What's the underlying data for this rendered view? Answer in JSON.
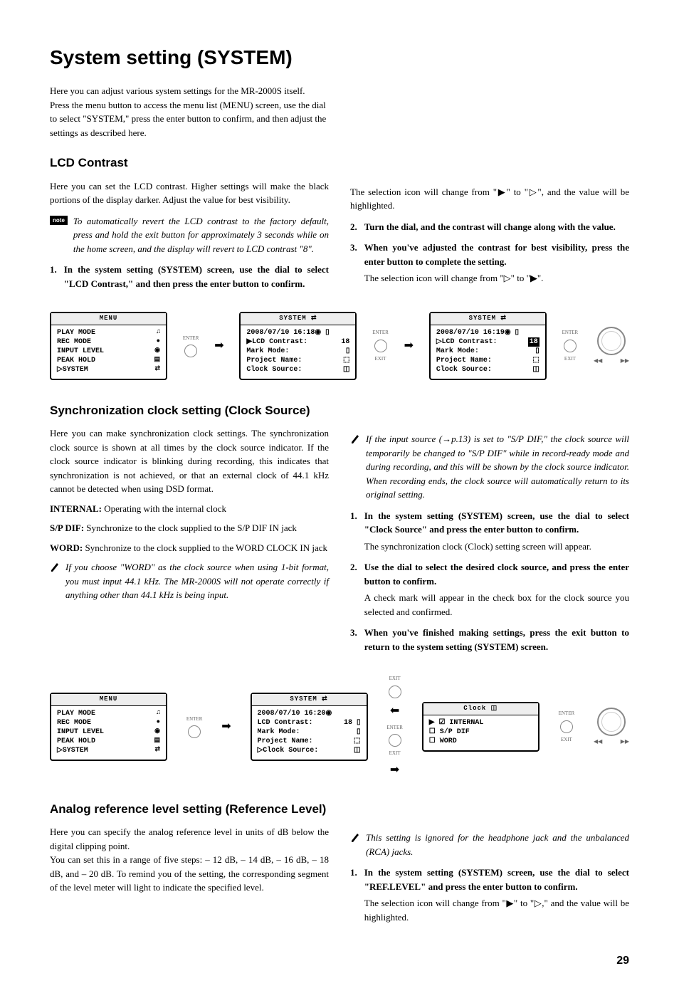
{
  "page": {
    "title": "System setting (SYSTEM)",
    "page_number": "29"
  },
  "intro": {
    "p1": "Here you can adjust various system settings for the MR-2000S itself.",
    "p2": "Press the menu button to access the menu list (MENU) screen, use the dial to select \"SYSTEM,\" press the enter button to confirm, and then adjust the settings as described here."
  },
  "lcd": {
    "title": "LCD Contrast",
    "p1": "Here you can set the LCD contrast. Higher settings will make the black portions of the display darker. Adjust the value for best visibility.",
    "note": "To automatically revert the LCD contrast to the factory default, press and hold the exit button for approximately 3 seconds while on the home screen, and the display will revert to LCD contrast \"8\".",
    "note_label": "note",
    "step1": "In the system setting (SYSTEM) screen, use the dial to select \"LCD Contrast,\" and then press the enter button to confirm.",
    "col2_p1": "The selection icon will change from \"▶\" to \"▷\", and the value will be highlighted.",
    "step2": "Turn the dial, and the contrast will change along with the value.",
    "step3": "When you've adjusted the contrast for best visibility, press the enter button to complete the setting.",
    "step3_note": "The selection icon will change from \"▷\" to \"▶\".",
    "n1": "1.",
    "n2": "2.",
    "n3": "3."
  },
  "sync": {
    "title": "Synchronization clock setting (Clock Source)",
    "p1": "Here you can make synchronization clock settings. The synchronization clock source is shown at all times by the clock source indicator. If the clock source indicator is blinking during recording, this indicates that synchronization is not achieved, or that an external clock of 44.1 kHz cannot be detected when using DSD format.",
    "internal_lbl": "INTERNAL:",
    "internal_txt": " Operating with the internal clock",
    "spdif_lbl": "S/P DIF:",
    "spdif_txt": " Synchronize to the clock supplied to the S/P DIF IN jack",
    "word_lbl": "WORD:",
    "word_txt": " Synchronize to the clock supplied to the WORD CLOCK IN jack",
    "warn1": "If you choose \"WORD\" as the clock source when using 1-bit format, you must input 44.1 kHz. The MR-2000S will not operate correctly if anything other than 44.1 kHz is being input.",
    "warn2": "If the input source (→p.13) is set to \"S/P DIF,\" the clock source will temporarily be changed to \"S/P DIF\" while in record-ready mode and during recording, and this will be shown by the clock source indicator. When recording ends, the clock source will automatically return to its original setting.",
    "step1": "In the system setting (SYSTEM) screen, use the dial to select \"Clock Source\" and press the enter button to confirm.",
    "step1_note": "The synchronization clock (Clock) setting screen will appear.",
    "step2": "Use the dial to select the desired clock source, and press the enter button to confirm.",
    "step2_note": "A check mark will appear in the check box for the clock source you selected and confirmed.",
    "step3": "When you've finished making settings, press the exit button to return to the system setting (SYSTEM) screen.",
    "n1": "1.",
    "n2": "2.",
    "n3": "3."
  },
  "analog": {
    "title": "Analog reference level setting (Reference Level)",
    "p1": "Here you can specify the analog reference level in units of dB below the digital clipping point.",
    "p2": "You can set this in a range of five steps: – 12 dB, – 14 dB, – 16 dB, – 18 dB, and – 20 dB. To remind you of the setting, the corresponding segment of the level meter will light to indicate the specified level.",
    "warn": "This setting is ignored for the headphone jack and the unbalanced (RCA) jacks.",
    "step1": " In the system setting (SYSTEM) screen, use the dial to select \"REF.LEVEL\" and press the enter button to confirm.",
    "step1_note": "The selection icon will change from \"▶\" to \"▷,\" and the value will be highlighted.",
    "n1": "1."
  },
  "screens": {
    "menu": {
      "title": "MENU",
      "r1": "PLAY MODE",
      "r2": "REC MODE",
      "r3": "INPUT LEVEL",
      "r4": "PEAK HOLD",
      "r5": "▷SYSTEM",
      "i1": "♫",
      "i2": "●",
      "i3": "◉",
      "i4": "▤",
      "i5": "⇄"
    },
    "sys1": {
      "title": "SYSTEM ⇄",
      "date": "2008/07/10 16:18◉ ▯",
      "r1": "▶LCD Contrast:",
      "v1": "18",
      "r2": " Mark Mode:",
      "v2": "▯",
      "r3": " Project Name:",
      "v3": "⬚",
      "r4": " Clock Source:",
      "v4": "◫"
    },
    "sys2": {
      "title": "SYSTEM ⇄",
      "date": "2008/07/10 16:19◉ ▯",
      "r1": "▷LCD Contrast:",
      "v1": "18",
      "r2": " Mark Mode:",
      "v2": "▯",
      "r3": " Project Name:",
      "v3": "⬚",
      "r4": " Clock Source:",
      "v4": "◫"
    },
    "sys3": {
      "title": "SYSTEM ⇄",
      "date": "2008/07/10 16:20◉",
      "r1": " LCD Contrast:",
      "v1": "18 ▯",
      "r2": " Mark Mode:",
      "v2": "▯",
      "r3": " Project Name:",
      "v3": "⬚",
      "r4": "▷Clock Source:",
      "v4": "◫"
    },
    "clock": {
      "title": "Clock ◫",
      "r1": "▶ ☑ INTERNAL",
      "r2": "  ☐ S/P DIF",
      "r3": "  ☐ WORD"
    },
    "labels": {
      "enter": "ENTER",
      "exit": "EXIT",
      "prev": "◀◀",
      "next": "▶▶"
    }
  }
}
